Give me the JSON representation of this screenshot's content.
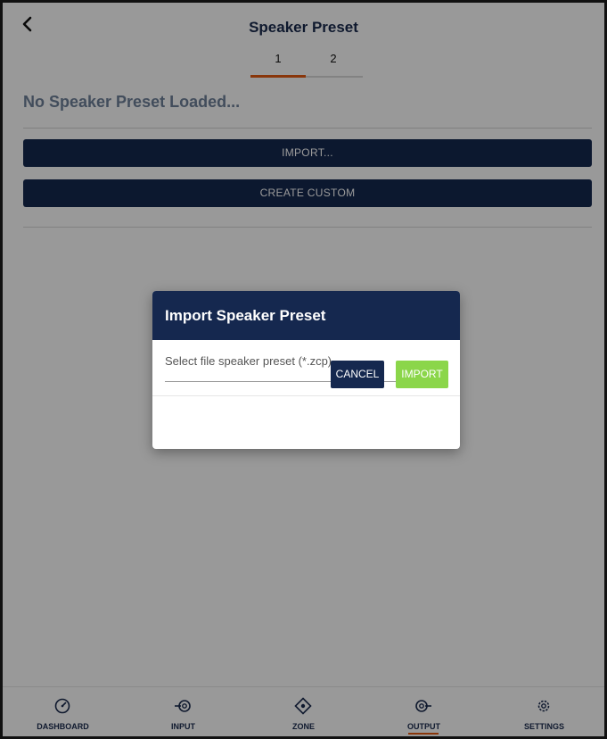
{
  "header": {
    "title": "Speaker Preset",
    "back_icon": "chevron-left-icon"
  },
  "tabs": [
    {
      "label": "1",
      "active": true
    },
    {
      "label": "2",
      "active": false
    }
  ],
  "main": {
    "status": "No Speaker Preset Loaded...",
    "import_button": "IMPORT...",
    "create_button": "CREATE CUSTOM"
  },
  "dialog": {
    "title": "Import Speaker Preset",
    "field_placeholder": "Select file speaker preset (*.zcp)",
    "cancel_label": "CANCEL",
    "import_label": "IMPORT"
  },
  "nav": {
    "items": [
      {
        "label": "DASHBOARD",
        "icon": "gauge-icon",
        "active": false
      },
      {
        "label": "INPUT",
        "icon": "input-icon",
        "active": false
      },
      {
        "label": "ZONE",
        "icon": "zone-icon",
        "active": false
      },
      {
        "label": "OUTPUT",
        "icon": "output-icon",
        "active": true
      },
      {
        "label": "SETTINGS",
        "icon": "gear-icon",
        "active": false
      }
    ]
  },
  "colors": {
    "primary": "#15284f",
    "accent": "#e55a11",
    "confirm": "#8bd64a",
    "status_text": "#6f8199"
  }
}
